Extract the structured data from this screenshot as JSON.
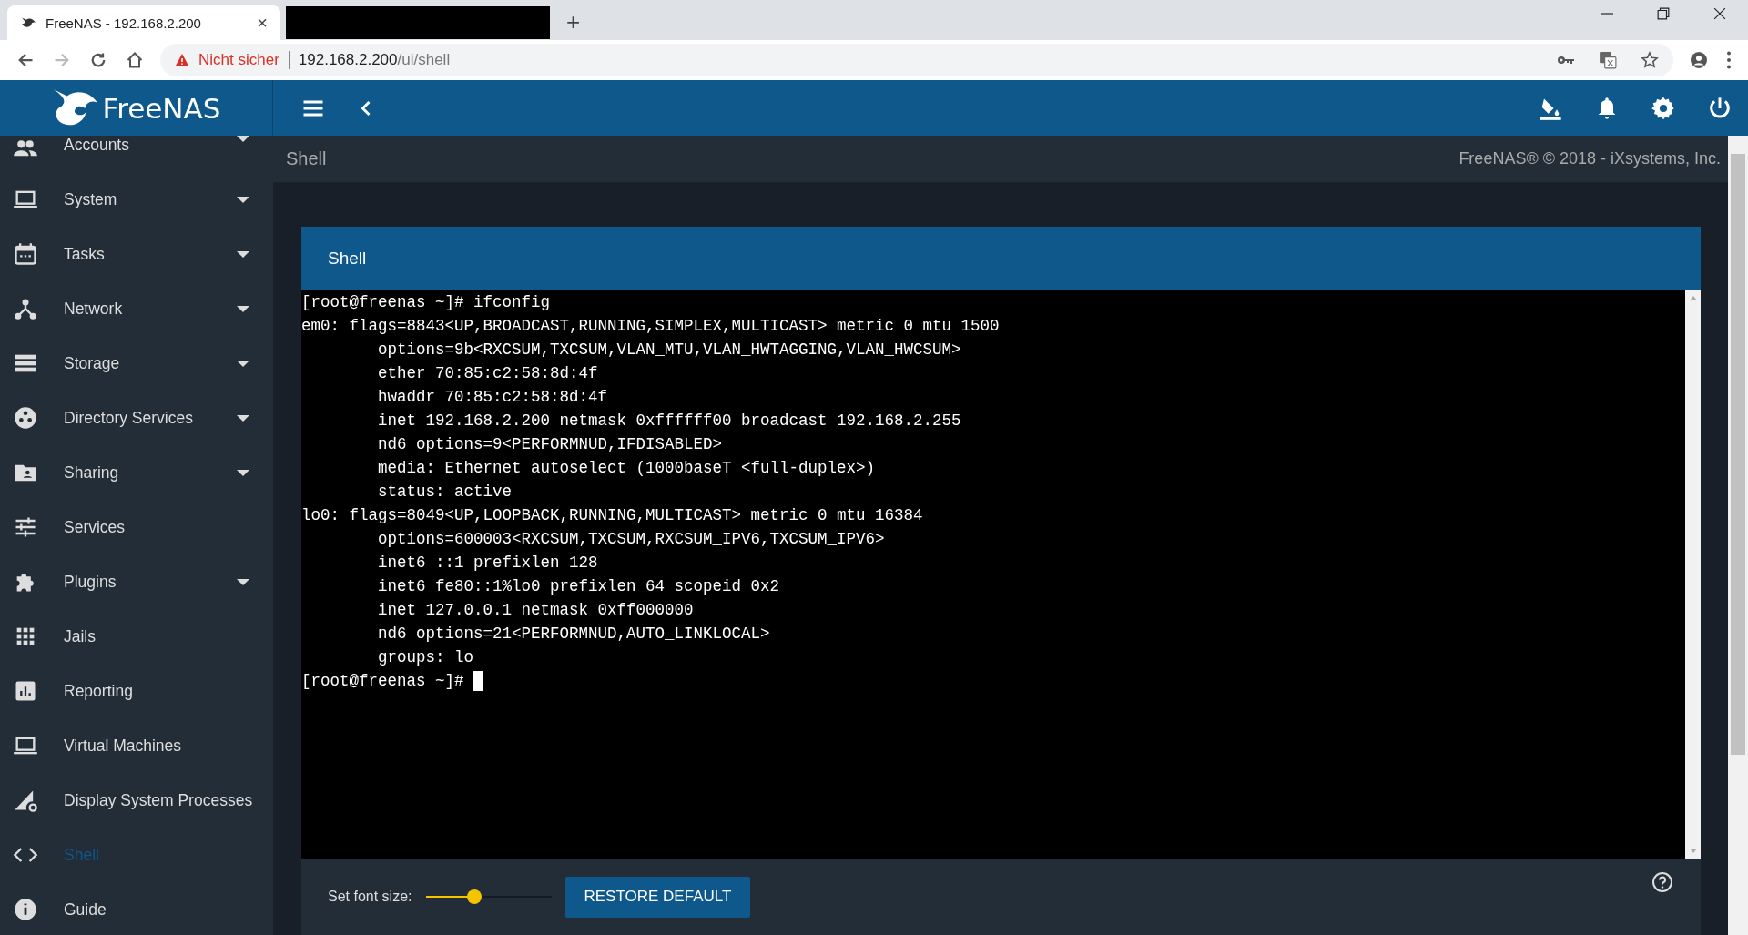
{
  "browser": {
    "tabs": [
      {
        "kind": "page",
        "title": "FreeNAS - 192.168.2.200",
        "close": "×",
        "selected": true
      },
      {
        "kind": "redacted",
        "selected": false
      }
    ],
    "new_tab": "+",
    "security_warning": "Nicht sicher",
    "url_host": "192.168.2.200",
    "url_path": "/ui/shell"
  },
  "header": {
    "logo_text": "FreeNAS"
  },
  "sidebar": {
    "items": [
      {
        "label": "Accounts",
        "kind": "people",
        "has_submenu": true,
        "selected": false
      },
      {
        "label": "System",
        "kind": "laptop",
        "has_submenu": true,
        "selected": false
      },
      {
        "label": "Tasks",
        "kind": "calendar",
        "has_submenu": true,
        "selected": false
      },
      {
        "label": "Network",
        "kind": "network",
        "has_submenu": true,
        "selected": false
      },
      {
        "label": "Storage",
        "kind": "storage",
        "has_submenu": true,
        "selected": false
      },
      {
        "label": "Directory Services",
        "kind": "directory",
        "has_submenu": true,
        "selected": false
      },
      {
        "label": "Sharing",
        "kind": "folder",
        "has_submenu": true,
        "selected": false
      },
      {
        "label": "Services",
        "kind": "sliders",
        "has_submenu": false,
        "selected": false
      },
      {
        "label": "Plugins",
        "kind": "puzzle",
        "has_submenu": true,
        "selected": false
      },
      {
        "label": "Jails",
        "kind": "grid",
        "has_submenu": false,
        "selected": false
      },
      {
        "label": "Reporting",
        "kind": "chart",
        "has_submenu": false,
        "selected": false
      },
      {
        "label": "Virtual Machines",
        "kind": "laptop",
        "has_submenu": false,
        "selected": false
      },
      {
        "label": "Display System Processes",
        "kind": "processes",
        "has_submenu": false,
        "selected": false
      },
      {
        "label": "Shell",
        "kind": "code",
        "has_submenu": false,
        "selected": true
      },
      {
        "label": "Guide",
        "kind": "info",
        "has_submenu": false,
        "selected": false
      }
    ]
  },
  "breadcrumb": "Shell",
  "copyright": "FreeNAS® © 2018 - iXsystems, Inc.",
  "card": {
    "title": "Shell",
    "terminal_lines": [
      "[root@freenas ~]# ifconfig",
      "em0: flags=8843<UP,BROADCAST,RUNNING,SIMPLEX,MULTICAST> metric 0 mtu 1500",
      "        options=9b<RXCSUM,TXCSUM,VLAN_MTU,VLAN_HWTAGGING,VLAN_HWCSUM>",
      "        ether 70:85:c2:58:8d:4f",
      "        hwaddr 70:85:c2:58:8d:4f",
      "        inet 192.168.2.200 netmask 0xffffff00 broadcast 192.168.2.255",
      "        nd6 options=9<PERFORMNUD,IFDISABLED>",
      "        media: Ethernet autoselect (1000baseT <full-duplex>)",
      "        status: active",
      "lo0: flags=8049<UP,LOOPBACK,RUNNING,MULTICAST> metric 0 mtu 16384",
      "        options=600003<RXCSUM,TXCSUM,RXCSUM_IPV6,TXCSUM_IPV6>",
      "        inet6 ::1 prefixlen 128",
      "        inet6 fe80::1%lo0 prefixlen 64 scopeid 0x2",
      "        inet 127.0.0.1 netmask 0xff000000",
      "        nd6 options=21<PERFORMNUD,AUTO_LINKLOCAL>",
      "        groups: lo",
      "[root@freenas ~]# "
    ],
    "font_size_label": "Set font size:",
    "font_size": {
      "level": 0.39
    },
    "restore_button": "RESTORE DEFAULT"
  }
}
